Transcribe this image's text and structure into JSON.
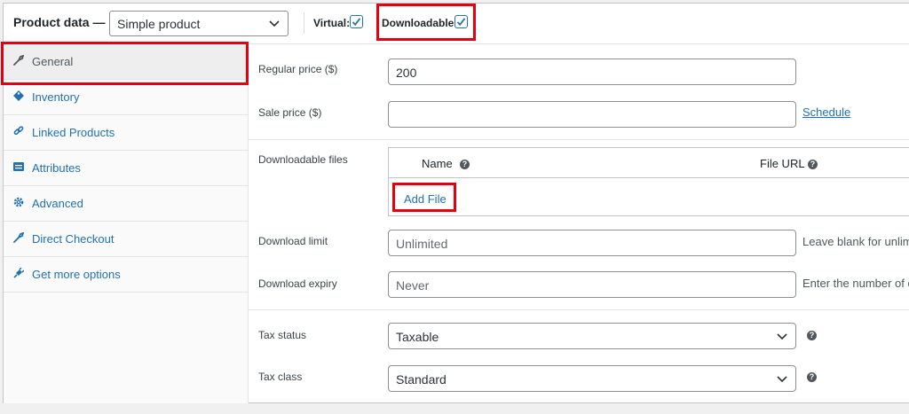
{
  "header": {
    "title": "Product data —",
    "product_type": "Simple product",
    "virtual_label": "Virtual:",
    "virtual_checked": true,
    "downloadable_label": "Downloadable:",
    "downloadable_checked": true
  },
  "sidebar": {
    "items": [
      {
        "label": "General",
        "icon": "wrench-icon",
        "active": true
      },
      {
        "label": "Inventory",
        "icon": "tag-icon"
      },
      {
        "label": "Linked Products",
        "icon": "link-icon"
      },
      {
        "label": "Attributes",
        "icon": "list-icon"
      },
      {
        "label": "Advanced",
        "icon": "gear-icon"
      },
      {
        "label": "Direct Checkout",
        "icon": "wrench-icon"
      },
      {
        "label": "Get more options",
        "icon": "plug-icon"
      }
    ]
  },
  "general": {
    "regular_price_label": "Regular price ($)",
    "regular_price_value": "200",
    "sale_price_label": "Sale price ($)",
    "sale_price_value": "",
    "schedule_link": "Schedule",
    "downloadable_files_label": "Downloadable files",
    "files_table": {
      "col_name": "Name",
      "col_url": "File URL",
      "add_file": "Add File"
    },
    "download_limit_label": "Download limit",
    "download_limit_placeholder": "Unlimited",
    "download_limit_hint": "Leave blank for unlim",
    "download_expiry_label": "Download expiry",
    "download_expiry_placeholder": "Never",
    "download_expiry_hint": "Enter the number of d",
    "tax_status_label": "Tax status",
    "tax_status_value": "Taxable",
    "tax_class_label": "Tax class",
    "tax_class_value": "Standard"
  },
  "colors": {
    "accent": "#2271b1",
    "highlight": "#e3000f"
  }
}
